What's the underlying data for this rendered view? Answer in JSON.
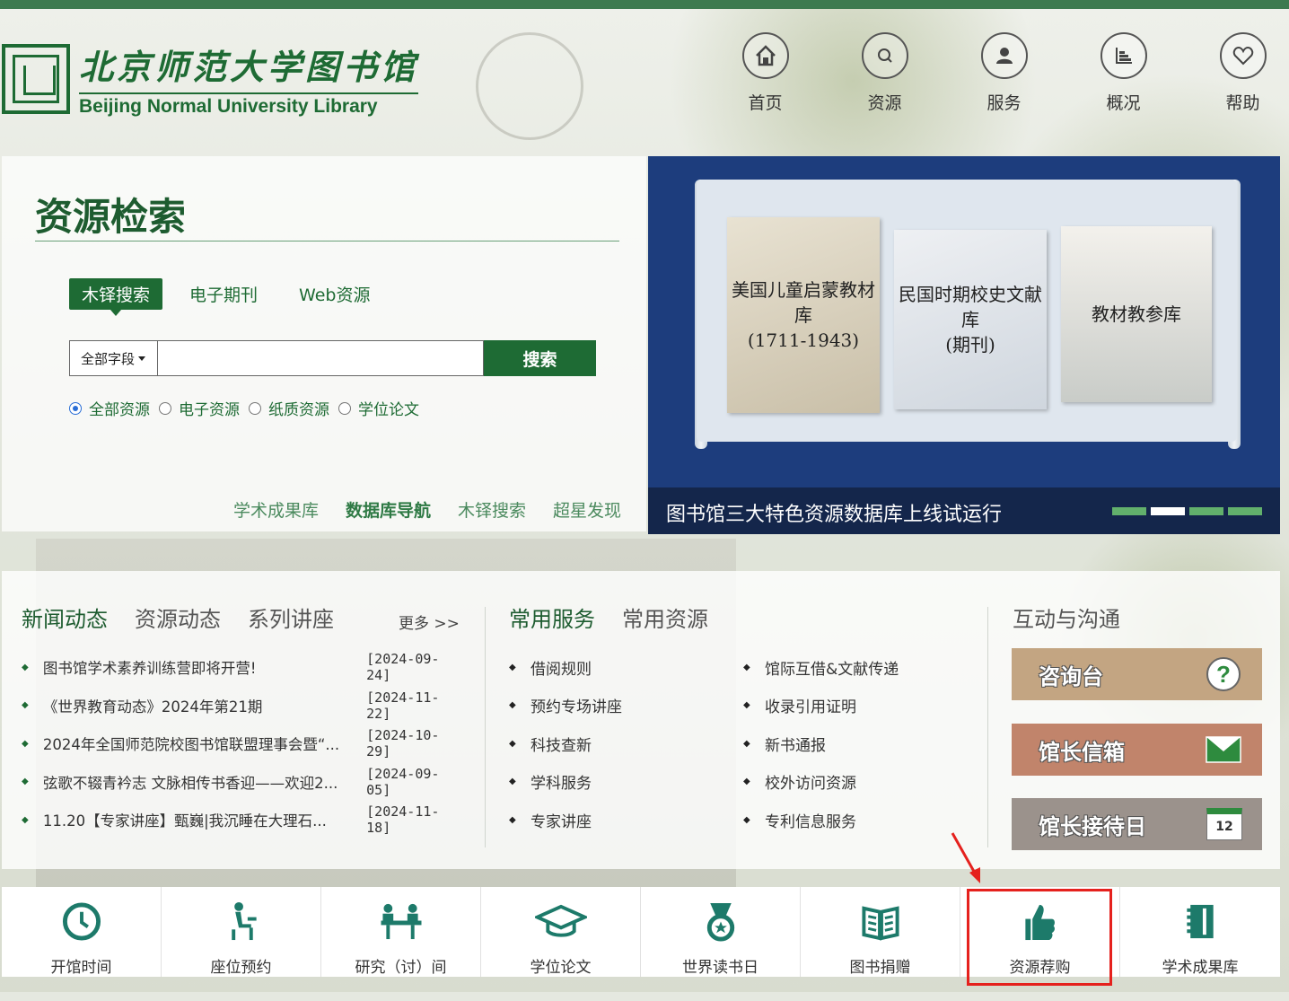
{
  "header": {
    "logo_cn": "北京师范大学图书馆",
    "logo_en": "Beijing Normal University Library",
    "nav": [
      {
        "label": "首页",
        "icon": "home-icon"
      },
      {
        "label": "资源",
        "icon": "search-icon"
      },
      {
        "label": "服务",
        "icon": "user-icon"
      },
      {
        "label": "概况",
        "icon": "chart-icon"
      },
      {
        "label": "帮助",
        "icon": "heart-icon"
      }
    ]
  },
  "search": {
    "title": "资源检索",
    "tabs": [
      "木铎搜索",
      "电子期刊",
      "Web资源"
    ],
    "field_select": "全部字段",
    "query_value": "",
    "button": "搜索",
    "radios": [
      "全部资源",
      "电子资源",
      "纸质资源",
      "学位论文"
    ],
    "links": [
      "学术成果库",
      "数据库导航",
      "木铎搜索",
      "超星发现"
    ]
  },
  "banner": {
    "books": [
      {
        "line1": "美国儿童启蒙教材库",
        "line2": "(1711-1943)"
      },
      {
        "line1": "民国时期校史文献库",
        "line2": "(期刊)"
      },
      {
        "line1": "教材教参库",
        "line2": ""
      }
    ],
    "caption": "图书馆三大特色资源数据库上线试运行",
    "slide_count": 4,
    "active_slide": 2
  },
  "news": {
    "tabs": [
      "新闻动态",
      "资源动态",
      "系列讲座"
    ],
    "more": "更多 >>",
    "items": [
      {
        "title": "图书馆学术素养训练营即将开营!",
        "date": "[2024-09-24]"
      },
      {
        "title": "《世界教育动态》2024年第21期",
        "date": "[2024-11-22]"
      },
      {
        "title": "2024年全国师范院校图书馆联盟理事会暨“...",
        "date": "[2024-10-29]"
      },
      {
        "title": "弦歌不辍青衿志 文脉相传书香迎——欢迎2...",
        "date": "[2024-09-05]"
      },
      {
        "title": "11.20【专家讲座】甄巍|我沉睡在大理石...",
        "date": "[2024-11-18]"
      }
    ]
  },
  "services": {
    "tabs": [
      "常用服务",
      "常用资源"
    ],
    "col1": [
      "借阅规则",
      "预约专场讲座",
      "科技查新",
      "学科服务",
      "专家讲座"
    ],
    "col2": [
      "馆际互借&文献传递",
      "收录引用证明",
      "新书通报",
      "校外访问资源",
      "专利信息服务"
    ]
  },
  "interact": {
    "title": "互动与沟通",
    "cards": [
      {
        "label": "咨询台",
        "color": "#c3a582",
        "icon": "question-icon"
      },
      {
        "label": "馆长信箱",
        "color": "#c1846b",
        "icon": "mail-icon"
      },
      {
        "label": "馆长接待日",
        "color": "#9b928c",
        "icon": "calendar-icon",
        "badge": "12"
      }
    ]
  },
  "quick_links": [
    {
      "label": "开馆时间",
      "icon": "clock-icon"
    },
    {
      "label": "座位预约",
      "icon": "seat-icon"
    },
    {
      "label": "研究（讨）间",
      "icon": "discussion-room-icon"
    },
    {
      "label": "学位论文",
      "icon": "graduation-cap-icon"
    },
    {
      "label": "世界读书日",
      "icon": "medal-icon"
    },
    {
      "label": "图书捐赠",
      "icon": "book-icon"
    },
    {
      "label": "资源荐购",
      "icon": "thumbs-up-icon"
    },
    {
      "label": "学术成果库",
      "icon": "notebook-icon"
    }
  ],
  "colors": {
    "brand_green": "#1e6b34",
    "highlight_red": "#e5211d",
    "banner_blue": "#1d3d7d"
  }
}
